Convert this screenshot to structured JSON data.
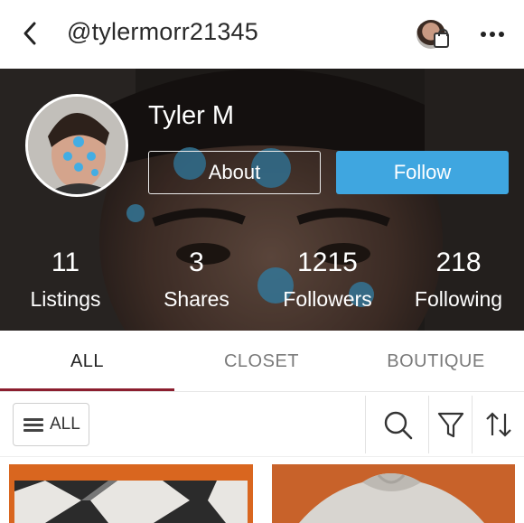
{
  "topbar": {
    "handle": "@tylermorr21345",
    "back_icon": "chevron-left-icon",
    "closet_icon": "avatar-bag-icon",
    "more_icon": "more-dots-icon"
  },
  "profile": {
    "name": "Tyler M",
    "about_label": "About",
    "follow_label": "Follow",
    "stats": [
      {
        "value": "11",
        "label": "Listings"
      },
      {
        "value": "3",
        "label": "Shares"
      },
      {
        "value": "1215",
        "label": "Followers"
      },
      {
        "value": "218",
        "label": "Following"
      }
    ]
  },
  "tabs": [
    {
      "label": "ALL",
      "active": true
    },
    {
      "label": "CLOSET",
      "active": false
    },
    {
      "label": "BOUTIQUE",
      "active": false
    }
  ],
  "filters": {
    "all_label": "ALL",
    "icons": [
      "search-icon",
      "filter-icon",
      "sort-icon"
    ]
  },
  "colors": {
    "accent_blue": "#3fa6e0",
    "tab_underline": "#8b1e2e"
  }
}
